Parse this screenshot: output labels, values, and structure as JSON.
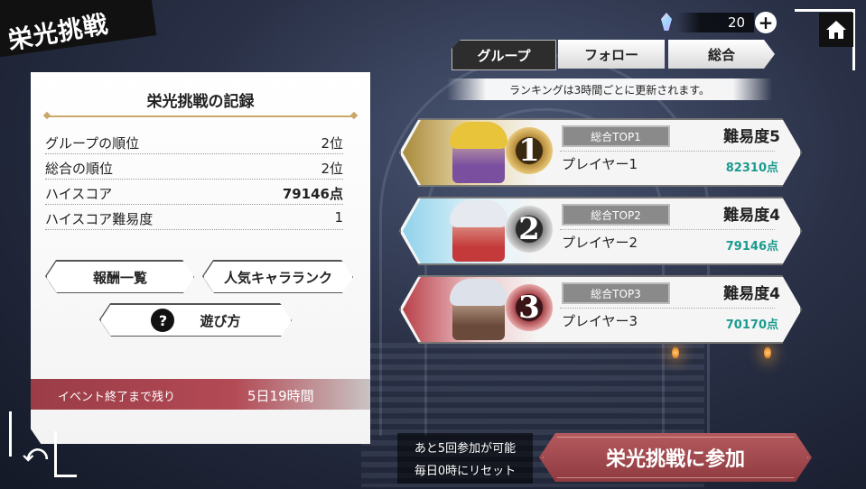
{
  "header": {
    "title": "栄光挑戦"
  },
  "currency": {
    "icon": "crystal-icon",
    "amount": "20",
    "plus": "+"
  },
  "tabs": [
    {
      "label": "グループ",
      "active": true
    },
    {
      "label": "フォロー",
      "active": false
    },
    {
      "label": "総合",
      "active": false
    }
  ],
  "notice": "ランキングは3時間ごとに更新されます。",
  "record": {
    "title": "栄光挑戦の記録",
    "stats": [
      {
        "label": "グループの順位",
        "value": "2位"
      },
      {
        "label": "総合の順位",
        "value": "2位"
      },
      {
        "label": "ハイスコア",
        "value": "79146点"
      },
      {
        "label": "ハイスコア難易度",
        "value": "1"
      }
    ],
    "buttons": {
      "rewards": "報酬一覧",
      "popular": "人気キャラランク",
      "howto": "遊び方",
      "help_icon": "?"
    },
    "event": {
      "label": "イベント終了まで残り",
      "value": "5日19時間"
    }
  },
  "rankings": [
    {
      "medal": "1",
      "badge": "総合TOP1",
      "difficulty": "難易度5",
      "player": "プレイヤー1",
      "score": "82310点",
      "medal_color": "#b48a3a",
      "bg_color": "#a88a3c"
    },
    {
      "medal": "2",
      "badge": "総合TOP2",
      "difficulty": "難易度4",
      "player": "プレイヤー2",
      "score": "79146点",
      "medal_color": "#777777",
      "bg_color": "#8fd2ea"
    },
    {
      "medal": "3",
      "badge": "総合TOP3",
      "difficulty": "難易度4",
      "player": "プレイヤー3",
      "score": "70170点",
      "medal_color": "#a8464c",
      "bg_color": "#b8404a"
    }
  ],
  "join": {
    "info_line1": "あと5回参加が可能",
    "info_line2": "毎日0時にリセット",
    "button": "栄光挑戦に参加"
  },
  "nav": {
    "home_icon": "home-icon",
    "back_icon": "back-arrow-icon",
    "back_glyph": "⤺"
  }
}
